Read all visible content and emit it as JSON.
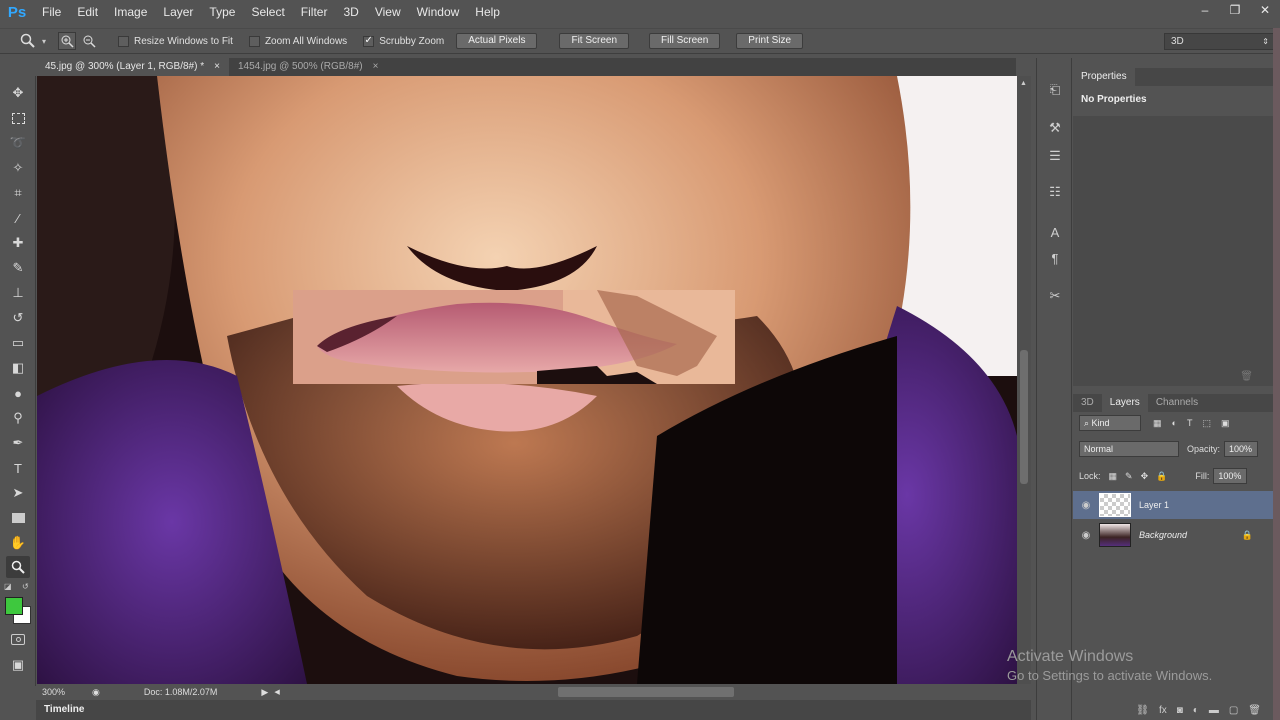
{
  "app": {
    "logo": "Ps",
    "menus": [
      "File",
      "Edit",
      "Image",
      "Layer",
      "Type",
      "Select",
      "Filter",
      "3D",
      "View",
      "Window",
      "Help"
    ],
    "window_controls": [
      "–",
      "❐",
      "✕"
    ]
  },
  "options_bar": {
    "resize_windows_to_fit": {
      "label": "Resize Windows to Fit",
      "checked": false
    },
    "zoom_all_windows": {
      "label": "Zoom All Windows",
      "checked": false
    },
    "scrubby_zoom": {
      "label": "Scrubby Zoom",
      "checked": true
    },
    "buttons": [
      "Actual Pixels",
      "Fit Screen",
      "Fill Screen",
      "Print Size"
    ],
    "workspace": "3D"
  },
  "tabs": [
    {
      "label": "45.jpg @ 300% (Layer 1, RGB/8#) *",
      "close": "×",
      "active": true
    },
    {
      "label": "1454.jpg @ 500% (RGB/8#)",
      "close": "×",
      "active": false
    }
  ],
  "status": {
    "zoom": "300%",
    "doc": "Doc: 1.08M/2.07M"
  },
  "timeline": "Timeline",
  "properties": {
    "tab": "Properties",
    "text": "No Properties"
  },
  "layers_panel": {
    "tabs": [
      "3D",
      "Layers",
      "Channels"
    ],
    "active_tab": "Layers",
    "filter": "Kind",
    "blend_mode": "Normal",
    "opacity_label": "Opacity:",
    "opacity": "100%",
    "lock_label": "Lock:",
    "fill_label": "Fill:",
    "fill": "100%",
    "layers": [
      {
        "name": "Layer 1",
        "selected": true,
        "locked": false
      },
      {
        "name": "Background",
        "selected": false,
        "locked": true
      }
    ]
  },
  "watermark": {
    "title": "Activate Windows",
    "subtitle": "Go to Settings to activate Windows."
  },
  "colors": {
    "foreground": "#3ec83e",
    "background": "#ffffff",
    "accent": "#31a8ff"
  }
}
